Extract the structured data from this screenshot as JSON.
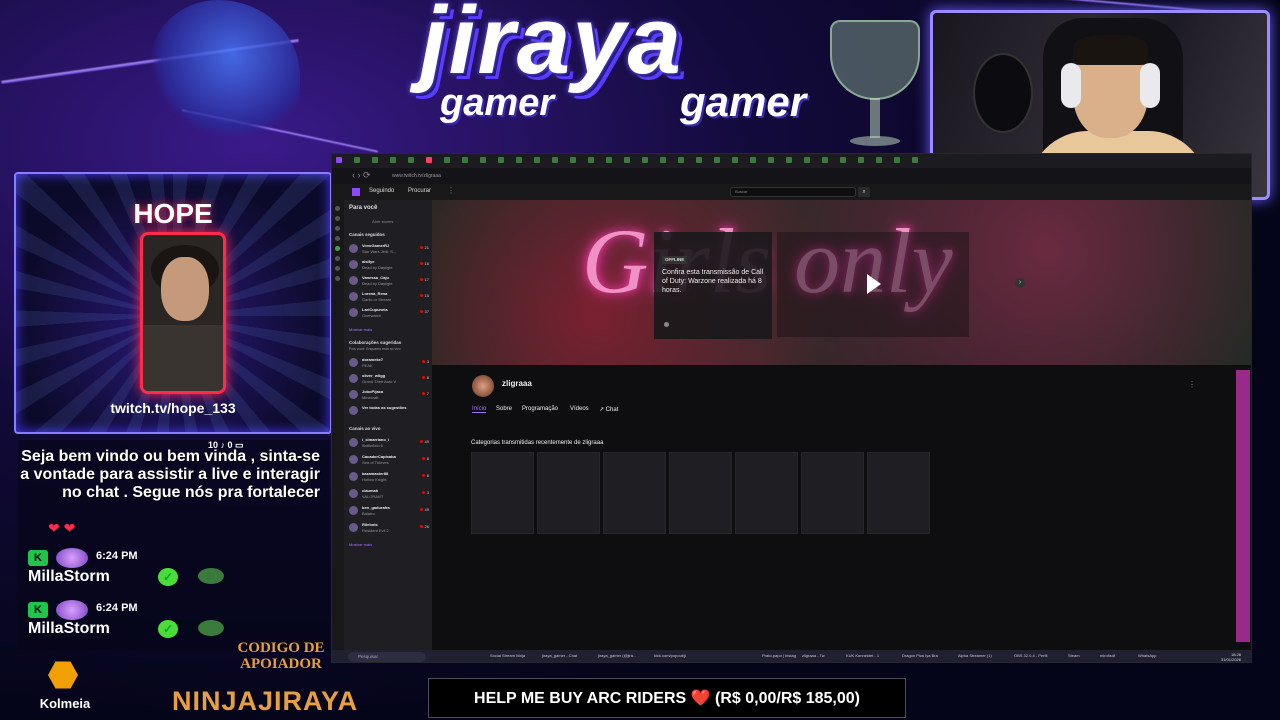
{
  "overlay": {
    "title_main": "jiraya",
    "title_sub_left": "gamer",
    "title_sub_right": "gamer",
    "accent_color": "#6a5cff"
  },
  "hope": {
    "title": "HOPE",
    "url": "twitch.tv/hope_133"
  },
  "chat": {
    "message": "Seja bem vindo ou bem vinda , sinta-se a vontade para assistir a live e interagir no chat . Segue nós pra fortalecer",
    "message_icons": "10 ♪ 0 ▭",
    "hearts": "❤ ❤",
    "lines": [
      {
        "badge": "K",
        "time": "6:24 PM",
        "name": "MillaStorm"
      },
      {
        "badge": "K",
        "time": "6:24 PM",
        "name": "MillaStorm"
      }
    ]
  },
  "footer": {
    "kolmeia": "Kolmeia",
    "codigo": "CODIGO DE APOIADOR",
    "ninja": "NINJAJIRAYA",
    "donate": "HELP ME BUY ARC RIDERS ❤️ (R$ 0,00/R$ 185,00)"
  },
  "browser": {
    "url": "www.twitch.tv/zligraaa",
    "nav_icons": "‹ › ⟳",
    "header": {
      "following": "Seguindo",
      "browse": "Procurar",
      "more": "⋮",
      "search_placeholder": "Buscar",
      "search_btn": "⌕"
    },
    "sidebar": {
      "for_you": "Para você",
      "stories": "Abrir stories",
      "followed": "Canais seguidos",
      "channels_followed": [
        {
          "name": "VovoGamerRJ",
          "game": "Star Wars Jedi: S...",
          "viewers": "21"
        },
        {
          "name": "alsifye",
          "game": "Dead by Daylight",
          "viewers": "18"
        },
        {
          "name": "Vanessa_Caju",
          "game": "Dead by Daylight",
          "viewers": "17"
        },
        {
          "name": "Lorena_Rena",
          "game": "Garlic or Stream",
          "viewers": "15"
        },
        {
          "name": "LariCupuneia",
          "game": "Overwatch",
          "viewers": "37"
        }
      ],
      "show_more": "Mostrar mais",
      "collab": "Colaborações sugeridas",
      "collab_sub": "Pois você: Enquanto está ao vivo",
      "channels_collab": [
        {
          "name": "dorameke7",
          "game": "PEAK",
          "viewers": "3"
        },
        {
          "name": "oliver_wilgg",
          "game": "Grand Theft Auto V",
          "viewers": "8"
        },
        {
          "name": "JoboPijaca",
          "game": "Minecraft",
          "viewers": "7"
        },
        {
          "name": "Ver todas as sugestões",
          "game": "",
          "viewers": ""
        }
      ],
      "live": "Canais ao vivo",
      "channels_live": [
        {
          "name": "i_cimarriano_l",
          "game": "Battlefield 6",
          "viewers": "49"
        },
        {
          "name": "CacadorCapixaba",
          "game": "Sea of Thieves",
          "viewers": "8"
        },
        {
          "name": "kazamaster88",
          "game": "Hollow Knight",
          "viewers": "6"
        },
        {
          "name": "claumah",
          "game": "VALORANT",
          "viewers": "3"
        },
        {
          "name": "ben_gadurafra",
          "game": "Balatro",
          "viewers": "49"
        },
        {
          "name": "Rilebots",
          "game": "Resident Evil 2",
          "viewers": "26"
        }
      ]
    },
    "banner_text": "Girls only",
    "offline": {
      "tag": "OFFLINE",
      "text": "Confira esta transmissão de Call of Duty: Warzone realizada há 8 horas."
    },
    "channel": {
      "name": "zligraaa",
      "tabs": [
        "Início",
        "Sobre",
        "Programação",
        "Vídeos",
        "↗ Chat"
      ],
      "categories_title": "Categorias transmitidas recentemente de zligraaa"
    },
    "taskbar": {
      "search": "Pesquisar",
      "items": [
        "Social Stream Ninja",
        "jiraya_gamer - Chat",
        "jiraya_gamer (@jira...",
        "kick.com/popout/ji",
        "Prato-papo | Instag",
        "zligraaa - Tw",
        "KUK Konnektet - 1",
        "Dragon Plus Iya Bra",
        "Alpha Streamer (1)",
        "OBS 32.0.4 - Perfil",
        "Steam",
        "mirofisdf",
        "WhatsApp"
      ],
      "time": "18:28",
      "date": "31/01/2026"
    }
  }
}
